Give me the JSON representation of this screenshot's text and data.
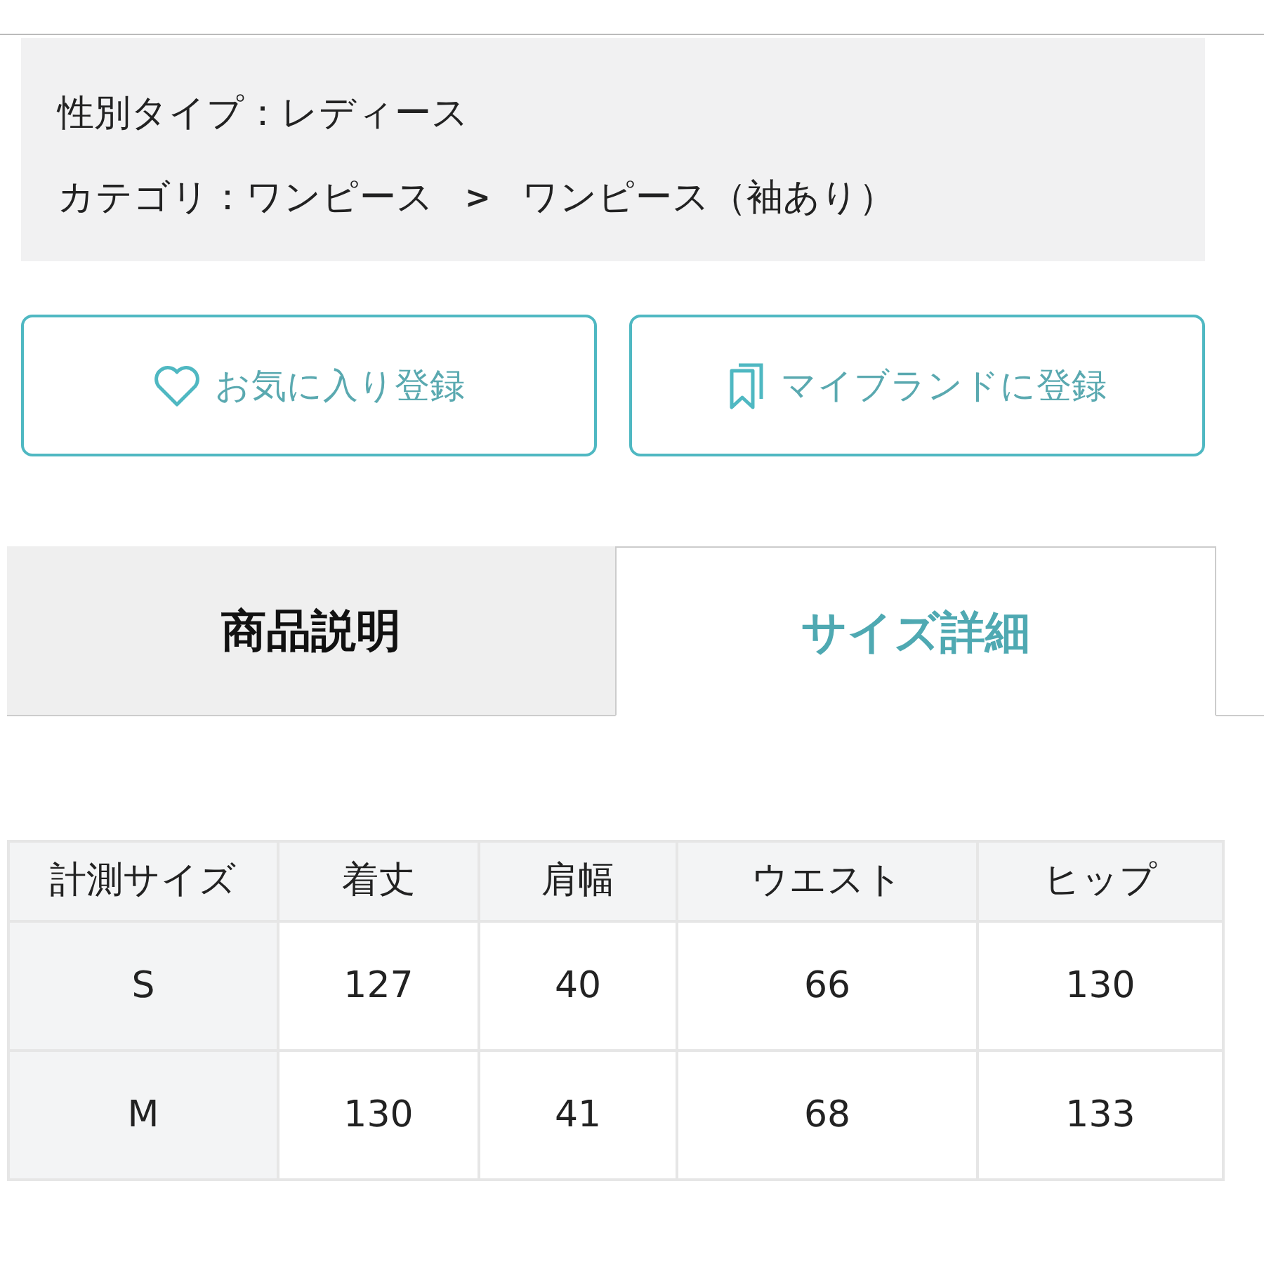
{
  "info": [
    {
      "kind": "text",
      "text": "性別タイプ：レディース"
    },
    {
      "kind": "breadcrumb",
      "parts": [
        "カテゴリ：ワンピース",
        "ワンピース（袖あり）"
      ],
      "separator": ">"
    }
  ],
  "buttons": [
    {
      "kind": "heart",
      "label": "お気に入り登録"
    },
    {
      "kind": "bookmark",
      "label": "マイブランドに登録"
    }
  ],
  "tabs": [
    {
      "label": "商品説明",
      "selected": false
    },
    {
      "label": "サイズ詳細",
      "selected": true
    }
  ],
  "size_table": {
    "columns": [
      "計測サイズ",
      "着丈",
      "肩幅",
      "ウエスト",
      "ヒップ"
    ],
    "rows": [
      [
        "S",
        "127",
        "40",
        "66",
        "130"
      ],
      [
        "M",
        "130",
        "41",
        "68",
        "133"
      ]
    ]
  }
}
